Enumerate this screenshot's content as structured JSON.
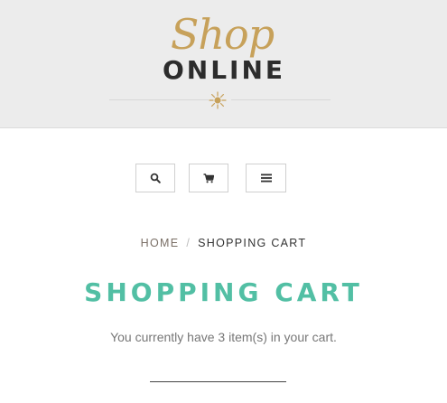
{
  "header": {
    "logo": {
      "script_text": "Shop",
      "main_text": "ONLINE"
    },
    "colors": {
      "background": "#ececec",
      "script": "#c7a15a",
      "main": "#2c2c2c"
    }
  },
  "toolbar": {
    "buttons": [
      {
        "name": "search",
        "icon": "search-icon"
      },
      {
        "name": "cart",
        "icon": "cart-icon"
      },
      {
        "name": "menu",
        "icon": "hamburger-menu-icon"
      }
    ]
  },
  "breadcrumb": {
    "home": "HOME",
    "separator": "/",
    "current": "SHOPPING CART"
  },
  "main": {
    "title": "SHOPPING CART",
    "title_color": "#52bfa4",
    "cart_message": "You currently have 3 item(s) in your cart."
  }
}
